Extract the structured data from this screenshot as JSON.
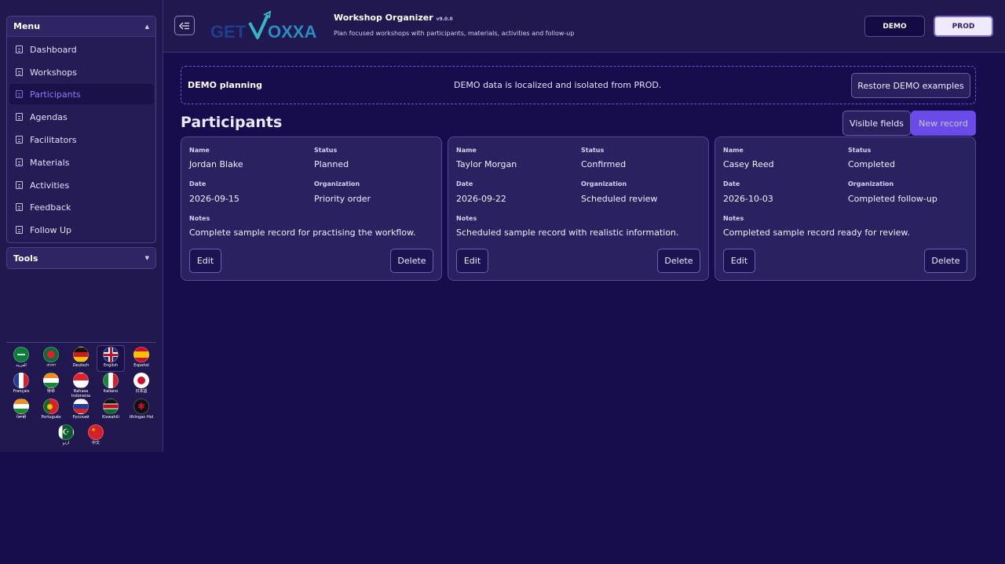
{
  "sidebar": {
    "menu_title": "Menu",
    "menu_items": [
      "Dashboard",
      "Workshops",
      "Participants",
      "Agendas",
      "Facilitators",
      "Materials",
      "Activities",
      "Feedback",
      "Follow Up"
    ],
    "active_item": "Participants",
    "tools_title": "Tools",
    "languages": [
      "العربية",
      "বাংলা",
      "Deutsch",
      "English",
      "Español",
      "Français",
      "हिन्दी",
      "Bahasa Indonesia",
      "Italiano",
      "日本語",
      "ਪੰਜਾਬੀ",
      "Português",
      "Русский",
      "Kiswahili",
      "tlhIngan Hol",
      "اردو",
      "中文"
    ],
    "active_language": "English"
  },
  "header": {
    "logo_text_left": "GET",
    "logo_text_right": "OXXA",
    "app_title": "Workshop Organizer",
    "version": "v9.0.0",
    "description": "Plan focused workshops with participants, materials, activities and follow-up",
    "demo_label": "DEMO",
    "prod_label": "PROD"
  },
  "banner": {
    "title": "DEMO planning",
    "message": "DEMO data is localized and isolated from PROD.",
    "restore_label": "Restore DEMO examples"
  },
  "main": {
    "section_title": "Participants",
    "visible_fields_label": "Visible fields",
    "new_record_label": "New record",
    "labels": {
      "name": "Name",
      "status": "Status",
      "date": "Date",
      "organization": "Organization",
      "notes": "Notes",
      "edit": "Edit",
      "delete": "Delete"
    },
    "records": [
      {
        "name": "Jordan Blake",
        "status": "Planned",
        "date": "2026-09-15",
        "organization": "Priority order",
        "notes": "Complete sample record for practising the workflow."
      },
      {
        "name": "Taylor Morgan",
        "status": "Confirmed",
        "date": "2026-09-22",
        "organization": "Scheduled review",
        "notes": "Scheduled sample record with realistic information."
      },
      {
        "name": "Casey Reed",
        "status": "Completed",
        "date": "2026-10-03",
        "organization": "Completed follow-up",
        "notes": "Completed sample record ready for review."
      }
    ]
  },
  "colors": {
    "background": "#170d4d",
    "panel": "#21184f",
    "accent": "#6a4ae8",
    "active_text": "#8f7cff"
  }
}
